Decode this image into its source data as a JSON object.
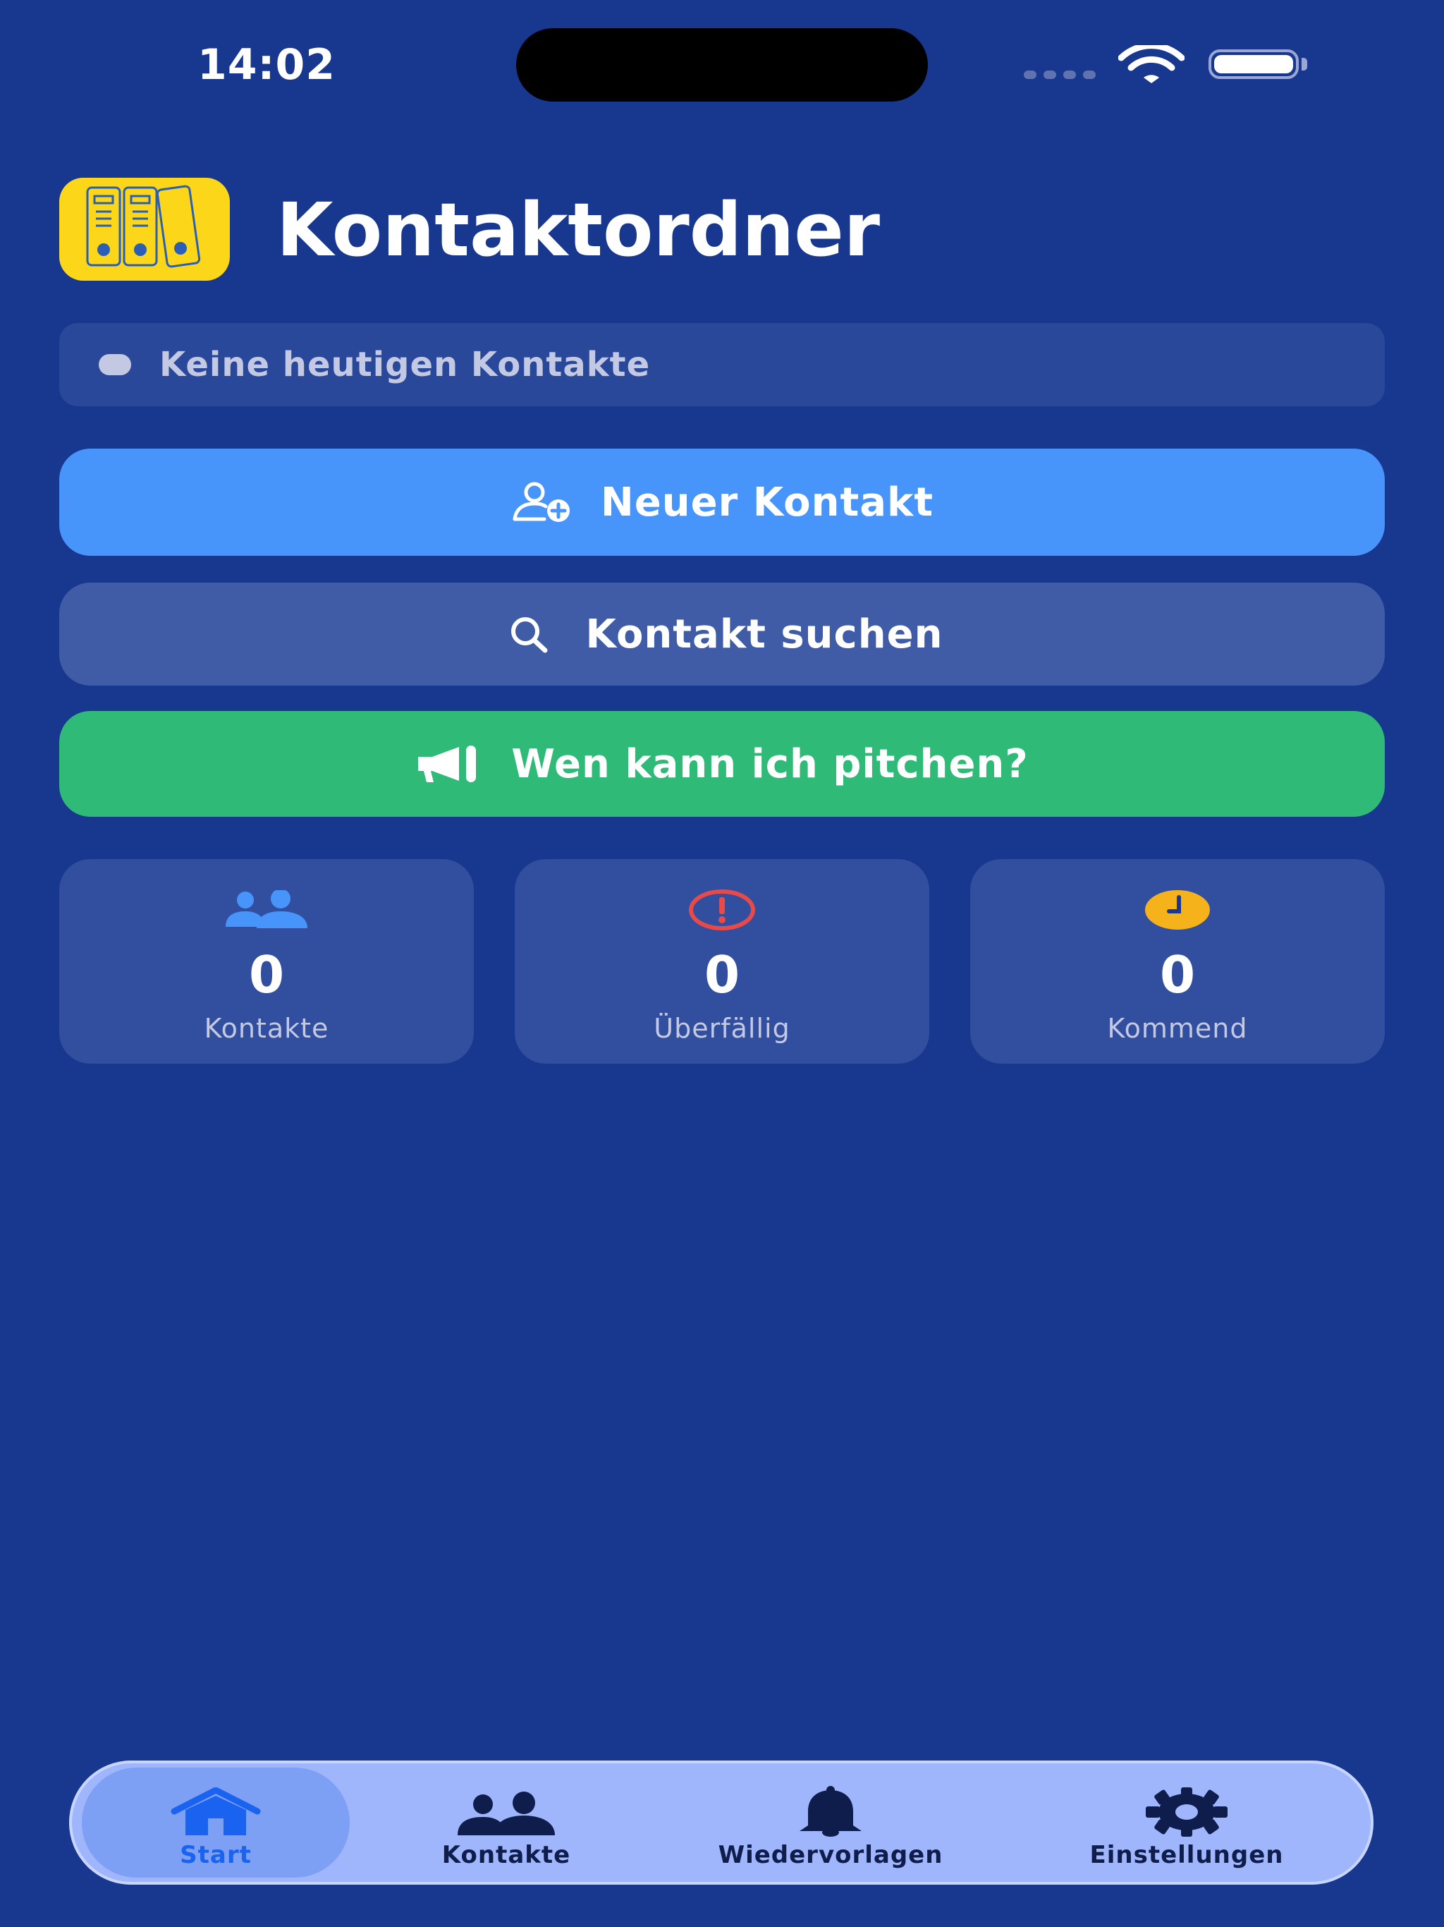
{
  "status_bar": {
    "time": "14:02"
  },
  "header": {
    "app_icon_label": "Kontaktordner",
    "title": "Kontaktordner"
  },
  "today": {
    "text": "Keine heutigen Kontakte"
  },
  "actions": {
    "new_contact": "Neuer Kontakt",
    "search_contact": "Kontakt suchen",
    "pitch": "Wen kann ich pitchen?"
  },
  "stats": [
    {
      "icon": "people-icon",
      "value": "0",
      "label": "Kontakte",
      "color": "#4795fb"
    },
    {
      "icon": "exclamation-circle-icon",
      "value": "0",
      "label": "Überfällig",
      "color": "#e84a4a"
    },
    {
      "icon": "clock-icon",
      "value": "0",
      "label": "Kommend",
      "color": "#f5b21b"
    }
  ],
  "tab_bar": {
    "items": [
      {
        "label": "Start",
        "icon": "house-icon",
        "active": true
      },
      {
        "label": "Kontakte",
        "icon": "people-icon",
        "active": false
      },
      {
        "label": "Wiedervorlagen",
        "icon": "bell-icon",
        "active": false
      },
      {
        "label": "Einstellungen",
        "icon": "gear-icon",
        "active": false
      }
    ]
  },
  "colors": {
    "background": "#18388f",
    "primary_button": "#4795fb",
    "secondary_button": "#405ca6",
    "pitch_button": "#2fba78",
    "app_icon": "#fcd619",
    "tab_bar": "#9fb6fc",
    "tab_active": "#1a63f0"
  }
}
